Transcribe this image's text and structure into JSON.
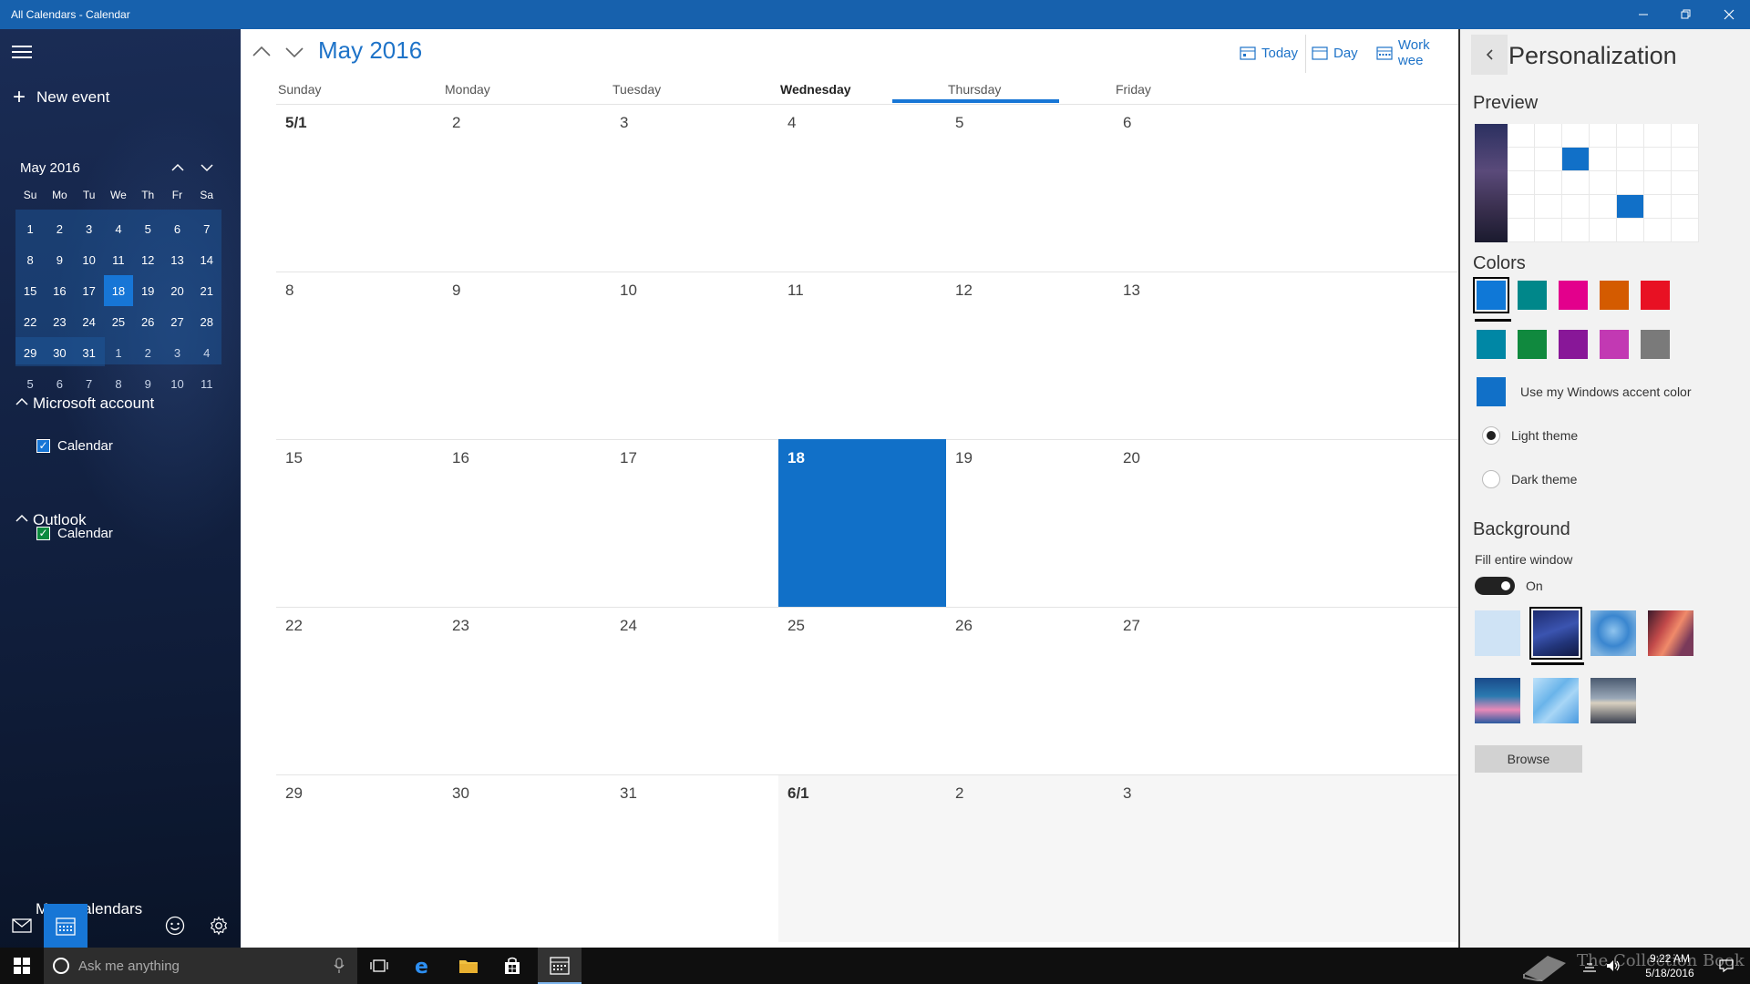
{
  "window": {
    "title": "All Calendars - Calendar"
  },
  "sidebar": {
    "new_event_label": "New event",
    "mini_calendar": {
      "month_label": "May 2016",
      "weekday_labels": [
        "Su",
        "Mo",
        "Tu",
        "We",
        "Th",
        "Fr",
        "Sa"
      ],
      "weeks": [
        [
          "1",
          "2",
          "3",
          "4",
          "5",
          "6",
          "7"
        ],
        [
          "8",
          "9",
          "10",
          "11",
          "12",
          "13",
          "14"
        ],
        [
          "15",
          "16",
          "17",
          "18",
          "19",
          "20",
          "21"
        ],
        [
          "22",
          "23",
          "24",
          "25",
          "26",
          "27",
          "28"
        ],
        [
          "29",
          "30",
          "31",
          "1",
          "2",
          "3",
          "4"
        ],
        [
          "5",
          "6",
          "7",
          "8",
          "9",
          "10",
          "11"
        ]
      ],
      "selected_day": "18"
    },
    "accounts": [
      {
        "name": "Microsoft account",
        "calendar_label": "Calendar",
        "checked": true
      },
      {
        "name": "Outlook",
        "calendar_label": "Calendar",
        "checked": true
      }
    ],
    "more_calendars_label": "More calendars"
  },
  "main": {
    "month_title": "May 2016",
    "views": {
      "today": "Today",
      "day": "Day",
      "work_week": "Work wee"
    },
    "weekdays": [
      "Sunday",
      "Monday",
      "Tuesday",
      "Wednesday",
      "Thursday",
      "Friday"
    ],
    "active_weekday": "Wednesday",
    "weeks": [
      [
        "5/1",
        "2",
        "3",
        "4",
        "5",
        "6"
      ],
      [
        "8",
        "9",
        "10",
        "11",
        "12",
        "13"
      ],
      [
        "15",
        "16",
        "17",
        "18",
        "19",
        "20"
      ],
      [
        "22",
        "23",
        "24",
        "25",
        "26",
        "27"
      ],
      [
        "29",
        "30",
        "31",
        "6/1",
        "2",
        "3"
      ]
    ],
    "today_label": "18"
  },
  "personalization": {
    "title": "Personalization",
    "preview_label": "Preview",
    "colors_label": "Colors",
    "colors": [
      "#0f78d7",
      "#00878a",
      "#e3008c",
      "#d45b00",
      "#e81123",
      "#0087a5",
      "#10893e",
      "#881798",
      "#c239b3",
      "#7a7a7a"
    ],
    "accent_color": "#1170c8",
    "use_accent_label": "Use my Windows accent color",
    "light_theme_label": "Light theme",
    "dark_theme_label": "Dark theme",
    "selected_theme": "light",
    "background_label": "Background",
    "fill_window_label": "Fill entire window",
    "toggle_state": "On",
    "browse_label": "Browse"
  },
  "taskbar": {
    "search_placeholder": "Ask me anything",
    "time": "9:22 AM",
    "date": "5/18/2016",
    "watermark": "The Collection Book"
  }
}
